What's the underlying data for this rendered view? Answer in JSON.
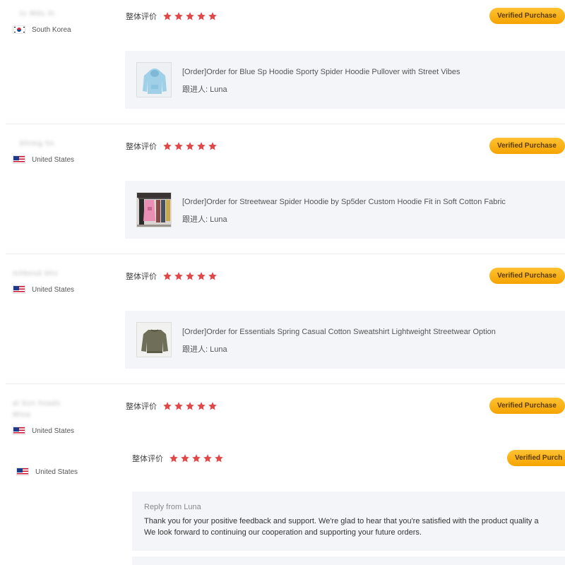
{
  "reviews": [
    {
      "username": "tu Mdu kt",
      "country": "South Korea",
      "flag": "kr-flag-icon",
      "rating_label": "整体评价",
      "stars": 5,
      "badge": "Verified Purchase",
      "order": {
        "title": "[Order]Order for Blue Sp Hoodie Sporty Spider Hoodie Pullover with Street Vibes",
        "follow": "跟进人: Luna",
        "thumb": "blue-hoodie-thumbnail"
      }
    },
    {
      "username": "bhtmg hn",
      "country": "United States",
      "flag": "us-flag-icon",
      "rating_label": "整体评价",
      "stars": 5,
      "badge": "Verified Purchase",
      "order": {
        "title": "[Order]Order for Streetwear Spider Hoodie by Sp5der Custom Hoodie Fit in Soft Cotton Fabric",
        "follow": "跟进人: Luna",
        "thumb": "clothing-rack-thumbnail"
      }
    },
    {
      "username": "mhbesd bhs",
      "country": "United States",
      "flag": "us-flag-icon",
      "rating_label": "整体评价",
      "stars": 5,
      "badge": "Verified Purchase",
      "order": {
        "title": "[Order]Order for Essentials Spring Casual Cotton Sweatshirt Lightweight Streetwear Option",
        "follow": "跟进人: Luna",
        "thumb": "olive-sweatshirt-thumbnail"
      }
    },
    {
      "username": "al bsn hsads",
      "username_2": "Mtsa",
      "country": "United States",
      "flag": "us-flag-icon",
      "rating_label": "整体评价",
      "stars": 5,
      "badge": "Verified Purchase"
    },
    {
      "country": "United States",
      "flag": "us-flag-icon",
      "rating_label": "整体评价",
      "stars": 5,
      "badge": "Verified Purch",
      "reply": {
        "from": "Reply from Luna",
        "line1": "Thank you for your positive feedback and support. We're glad to hear that you're satisfied with the product quality a",
        "line2": "We look forward to continuing our cooperation and supporting your future orders."
      }
    }
  ],
  "colors": {
    "star": "#e04848",
    "badge_top": "#ffc233",
    "badge_bottom": "#f5a400",
    "box_bg": "#f4f5f8"
  }
}
